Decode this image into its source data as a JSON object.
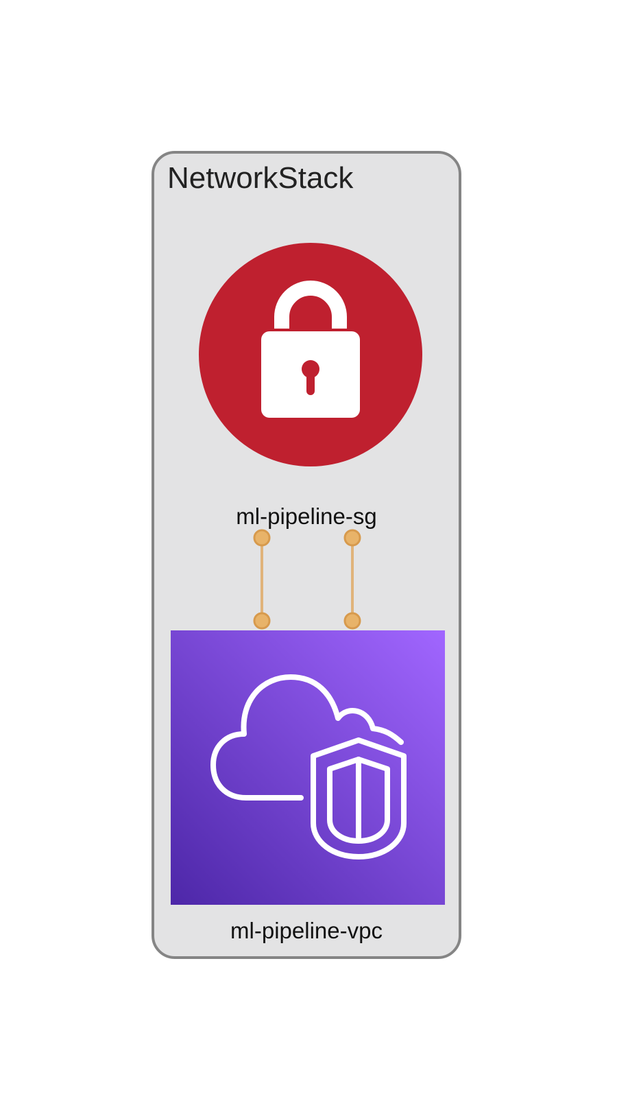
{
  "stack": {
    "title": "NetworkStack"
  },
  "nodes": {
    "security_group": {
      "label": "ml-pipeline-sg",
      "icon": "padlock-icon",
      "color": "#bf202f"
    },
    "vpc": {
      "label": "ml-pipeline-vpc",
      "icon": "cloud-shield-icon",
      "gradient": [
        "#4d27a8",
        "#a166ff"
      ]
    }
  },
  "edges": [
    {
      "from": "ml-pipeline-sg",
      "to": "ml-pipeline-vpc",
      "color": "#e0b37a"
    },
    {
      "from": "ml-pipeline-sg",
      "to": "ml-pipeline-vpc",
      "color": "#e0b37a"
    }
  ]
}
